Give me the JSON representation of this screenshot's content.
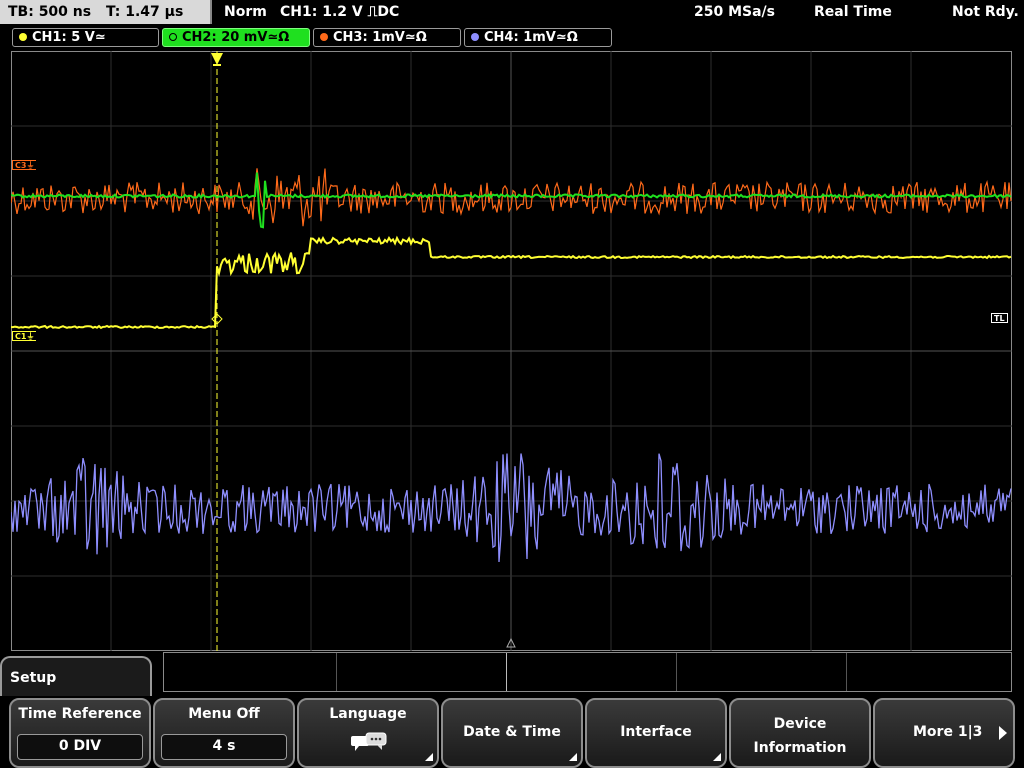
{
  "topbar": {
    "timebase": "TB: 500 ns",
    "trigger_time": "T: 1.47 µs",
    "trigger_mode": "Norm",
    "trigger_info": "CH1: 1.2 V ⎍DC",
    "sample_rate": "250 MSa/s",
    "acq_mode": "Real Time",
    "status": "Not Rdy."
  },
  "channels": [
    {
      "label": "CH1: 5 V≃",
      "color": "#ffff33"
    },
    {
      "label": "CH2: 20 mV≃Ω",
      "color": "#1fe01f"
    },
    {
      "label": "CH3: 1mV≃Ω",
      "color": "#ff6a1a"
    },
    {
      "label": "CH4: 1mV≃Ω",
      "color": "#8f8fff"
    }
  ],
  "markers": {
    "c3": "C3⏚",
    "c1": "C1⏚",
    "trigger_level": "TL"
  },
  "menu": {
    "title": "Setup",
    "softkeys": {
      "time_reference": {
        "label": "Time Reference",
        "value": "0 DIV"
      },
      "menu_off": {
        "label": "Menu Off",
        "value": "4 s"
      },
      "language": {
        "label": "Language",
        "icon": "speech-bubbles-icon"
      },
      "date_time": {
        "label": "Date & Time"
      },
      "interface": {
        "label": "Interface"
      },
      "device_info": {
        "label_line1": "Device",
        "label_line2": "Information"
      },
      "more": {
        "label": "More 1|3"
      }
    }
  },
  "colors": {
    "ch1": "#ffff33",
    "ch2": "#1fe01f",
    "ch3": "#ff6a1a",
    "ch4": "#8f8fff",
    "grid": "#3a3a3a"
  }
}
